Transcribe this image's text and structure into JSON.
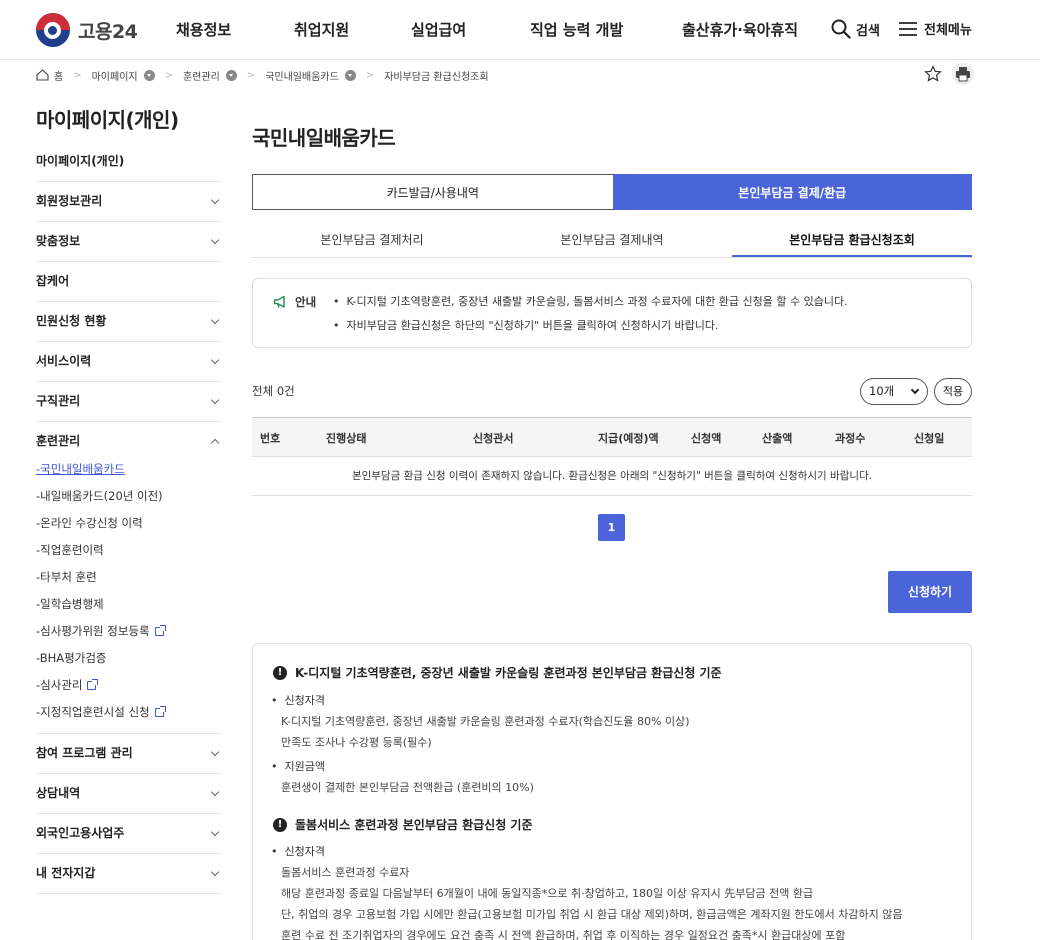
{
  "header": {
    "logo_text": "고용24",
    "nav": [
      "채용정보",
      "취업지원",
      "실업급여",
      "직업 능력 개발",
      "출산휴가·육아휴직"
    ],
    "search_label": "검색",
    "menu_label": "전체메뉴"
  },
  "breadcrumb": [
    "홈",
    "마이페이지",
    "훈련관리",
    "국민내일배움카드",
    "자비부담금 환급신청조회"
  ],
  "sidebar": {
    "title": "마이페이지(개인)",
    "first": "마이페이지(개인)",
    "groups": [
      "회원정보관리",
      "맞춤정보",
      "잡케어",
      "민원신청 현황",
      "서비스이력",
      "구직관리",
      "훈련관리"
    ],
    "sub_items": [
      "국민내일배움카드",
      "내일배움카드(20년 이전)",
      "온라인 수강신청 이력",
      "직업훈련이력",
      "타부처 훈련",
      "일학습병행제",
      "심사평가위원 정보등록",
      "BHA평가검증",
      "심사관리",
      "지정직업훈련시설 신청"
    ],
    "groups_after": [
      "참여 프로그램 관리",
      "상담내역",
      "외국인고용사업주",
      "내 전자지갑"
    ]
  },
  "main": {
    "title": "국민내일배움카드",
    "seg_tabs": [
      "카드발급/사용내역",
      "본인부담금 결제/환급"
    ],
    "sub_tabs": [
      "본인부담금 결제처리",
      "본인부담금 결제내역",
      "본인부담금 환급신청조회"
    ],
    "notice_label": "안내",
    "notice_lines": [
      "K-디지털 기초역량훈련, 중장년 새출발 카운슬링, 돌봄서비스 과정 수료자에 대한 환급 신청을 할 수 있습니다.",
      "자비부담금 환급신청은 하단의 \"신청하기\" 버튼을 클릭하여 신청하시기 바랍니다."
    ],
    "total": "전체 0건",
    "page_size": "10개",
    "apply_filter": "적용",
    "table_headers": [
      "번호",
      "진행상태",
      "신청관서",
      "지급(예정)액",
      "신청액",
      "산출액",
      "과정수",
      "신청일"
    ],
    "empty_message": "본인부담금 환급 신청 이력이 존재하지 않습니다. 환급신청은 아래의 \"신청하기\" 버튼을 클릭하여 신청하시기 바랍니다.",
    "page": "1",
    "apply_button": "신청하기"
  },
  "guide": {
    "sections": [
      {
        "title": "K-디지털 기초역량훈련, 중장년 새출발 카운슬링 훈련과정 본인부담금 환급신청 기준",
        "bullet1": "신청자격",
        "texts1": [
          "K-디지털 기초역량훈련, 중장년 새출발 카운슬링 훈련과정 수료자(학습진도율 80% 이상)",
          "만족도 조사나 수강평 등록(필수)"
        ],
        "bullet2": "지원금액",
        "texts2": [
          "훈련생이 결제한 본인부담금 전액환급 (훈련비의 10%)"
        ]
      },
      {
        "title": "돌봄서비스 훈련과정 본인부담금 환급신청 기준",
        "bullet1": "신청자격",
        "texts1": [
          "돌봄서비스 훈련과정 수료자",
          "해당 훈련과정 종료일 다음날부터 6개월이 내에 동일직종*으로 취·창업하고, 180일 이상 유지시 先부담금 전액 환급",
          "단, 취업의 경우 고용보험 가입 시에만 환급(고용보험 미가입 취업 시 환급 대상 제외)하며, 환급금액은 계좌지원 한도에서 차감하지 않음",
          "훈련 수료 전 조기취업자의 경우에도 요건 충족 시 전액 환급하며, 취업 후 이직하는 경우 일정요건 충족*시 환급대상에 포함"
        ]
      }
    ]
  }
}
